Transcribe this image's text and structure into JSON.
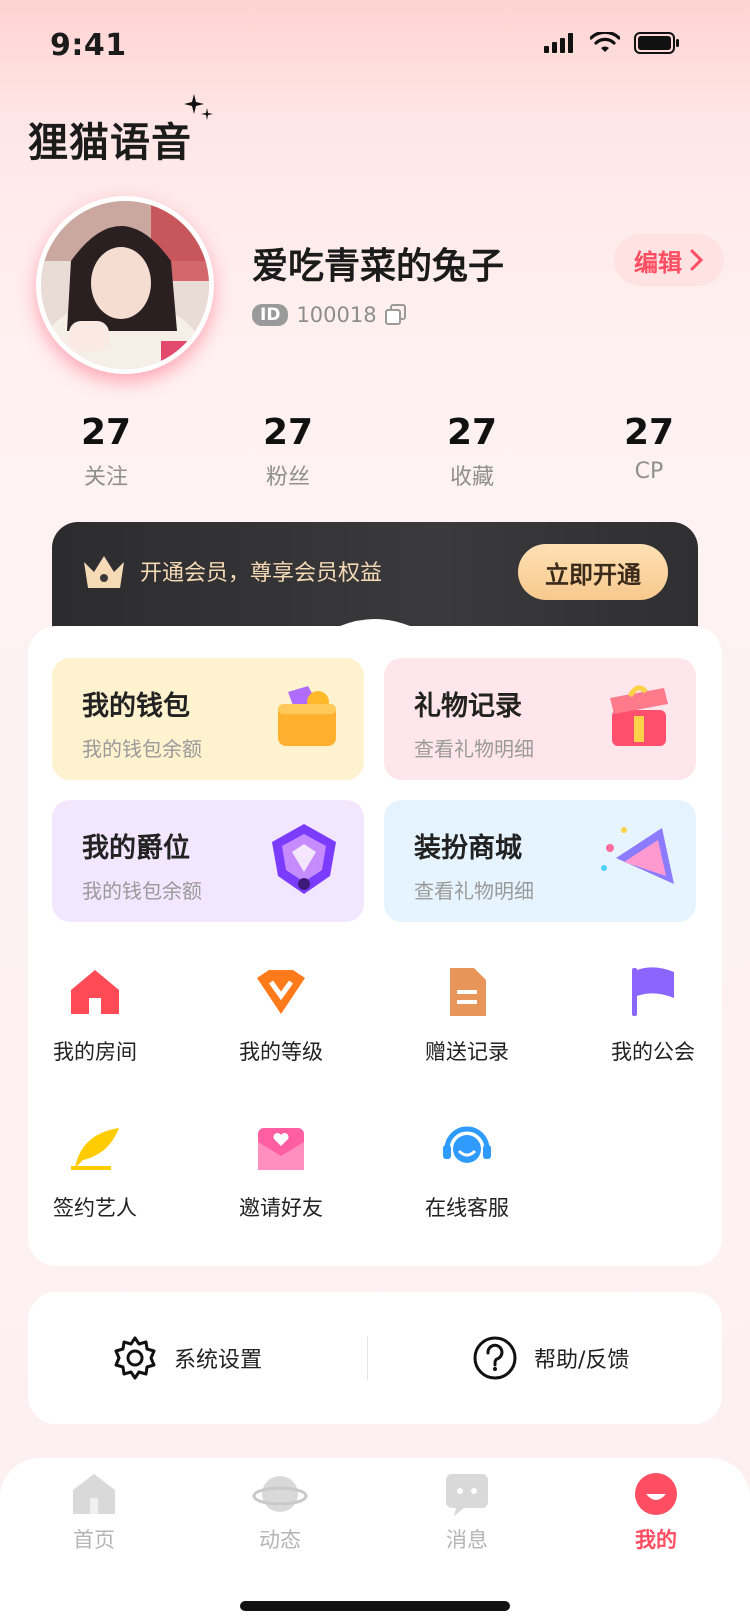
{
  "status_bar": {
    "time": "9:41"
  },
  "app": {
    "title": "狸猫语音"
  },
  "profile": {
    "nickname": "爱吃青菜的兔子",
    "id_label": "ID",
    "id_value": "100018",
    "edit_label": "编辑"
  },
  "stats": [
    {
      "value": "27",
      "label": "关注"
    },
    {
      "value": "27",
      "label": "粉丝"
    },
    {
      "value": "27",
      "label": "收藏"
    },
    {
      "value": "27",
      "label": "CP"
    }
  ],
  "vip": {
    "text": "开通会员，尊享会员权益",
    "button": "立即开通"
  },
  "tiles": [
    {
      "title": "我的钱包",
      "subtitle": "我的钱包余额",
      "icon": "wallet-icon",
      "bg": "#fff2cf"
    },
    {
      "title": "礼物记录",
      "subtitle": "查看礼物明细",
      "icon": "gift-box-icon",
      "bg": "#ffe6ec"
    },
    {
      "title": "我的爵位",
      "subtitle": "我的钱包余额",
      "icon": "crystal-badge-icon",
      "bg": "#f3e6ff"
    },
    {
      "title": "装扮商城",
      "subtitle": "查看礼物明细",
      "icon": "party-popper-icon",
      "bg": "#e6f4ff"
    }
  ],
  "grid": [
    {
      "label": "我的房间",
      "icon": "house-icon",
      "color": "#ff4b55"
    },
    {
      "label": "我的等级",
      "icon": "level-v-icon",
      "color": "#ff7a1a"
    },
    {
      "label": "赠送记录",
      "icon": "document-icon",
      "color": "#e8955a"
    },
    {
      "label": "我的公会",
      "icon": "flag-icon",
      "color": "#8a66ff"
    },
    {
      "label": "签约艺人",
      "icon": "feather-icon",
      "color": "#ffcc00"
    },
    {
      "label": "邀请好友",
      "icon": "invite-envelope-icon",
      "color": "#ff5fa2"
    },
    {
      "label": "在线客服",
      "icon": "headset-icon",
      "color": "#2f9bff"
    }
  ],
  "settings": [
    {
      "label": "系统设置",
      "icon": "gear-icon"
    },
    {
      "label": "帮助/反馈",
      "icon": "help-icon"
    }
  ],
  "nav": [
    {
      "label": "首页",
      "icon": "home-tab-icon",
      "active": false
    },
    {
      "label": "动态",
      "icon": "planet-tab-icon",
      "active": false
    },
    {
      "label": "消息",
      "icon": "message-tab-icon",
      "active": false
    },
    {
      "label": "我的",
      "icon": "profile-tab-icon",
      "active": true
    }
  ],
  "colors": {
    "accent": "#ff4d62",
    "vip_gold": "#f6d9b5",
    "inactive": "#b5b5b5"
  }
}
